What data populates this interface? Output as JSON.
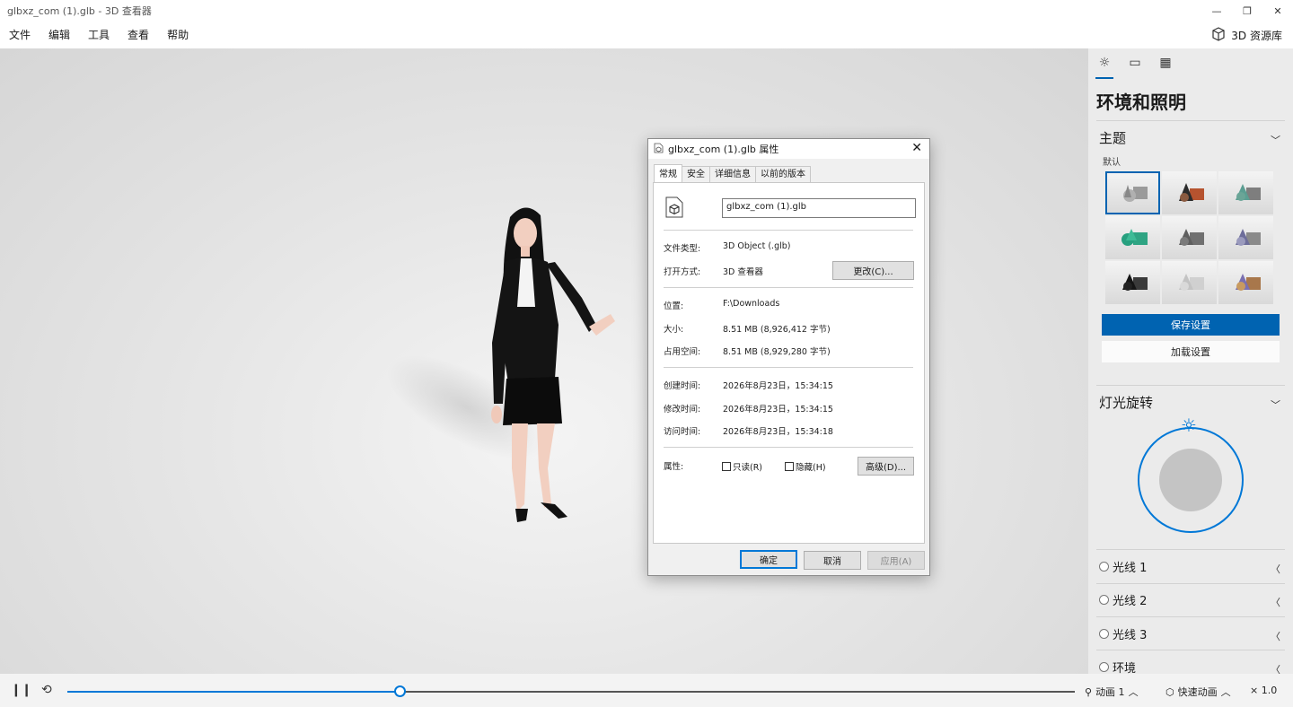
{
  "window": {
    "title": "glbxz_com (1).glb - 3D 查看器",
    "minimize": "—",
    "restore": "❐",
    "close": "✕"
  },
  "menu": {
    "items": [
      "文件",
      "编辑",
      "工具",
      "查看",
      "帮助"
    ],
    "library_label": "3D 资源库"
  },
  "dialog": {
    "title": "glbxz_com (1).glb 属性",
    "tabs": [
      "常规",
      "安全",
      "详细信息",
      "以前的版本"
    ],
    "filename": "glbxz_com (1).glb",
    "file_type_label": "文件类型:",
    "file_type_value": "3D Object (.glb)",
    "open_with_label": "打开方式:",
    "open_with_value": "3D 查看器",
    "change_button": "更改(C)...",
    "location_label": "位置:",
    "location_value": "F:\\Downloads",
    "size_label": "大小:",
    "size_value": "8.51 MB (8,926,412 字节)",
    "size_on_disk_label": "占用空间:",
    "size_on_disk_value": "8.51 MB (8,929,280 字节)",
    "created_label": "创建时间:",
    "created_value": "2026年8月23日，15:34:15",
    "modified_label": "修改时间:",
    "modified_value": "2026年8月23日，15:34:15",
    "accessed_label": "访问时间:",
    "accessed_value": "2026年8月23日，15:34:18",
    "attributes_label": "属性:",
    "readonly_label": "只读(R)",
    "hidden_label": "隐藏(H)",
    "advanced_button": "高级(D)...",
    "ok_button": "确定",
    "cancel_button": "取消",
    "apply_button": "应用(A)"
  },
  "panel": {
    "title": "环境和照明",
    "theme_heading": "主题",
    "theme_default_label": "默认",
    "save_button": "保存设置",
    "load_button": "加载设置",
    "light_rotation_heading": "灯光旋转",
    "lights": [
      "光线 1",
      "光线 2",
      "光线 3",
      "环境"
    ]
  },
  "bottom": {
    "animation_label": "动画 1",
    "quick_animation_label": "快速动画",
    "speed_label": "× 1.0",
    "progress": 0.33
  },
  "colors": {
    "accent": "#0078d7",
    "panel_accent": "#0063b1"
  }
}
